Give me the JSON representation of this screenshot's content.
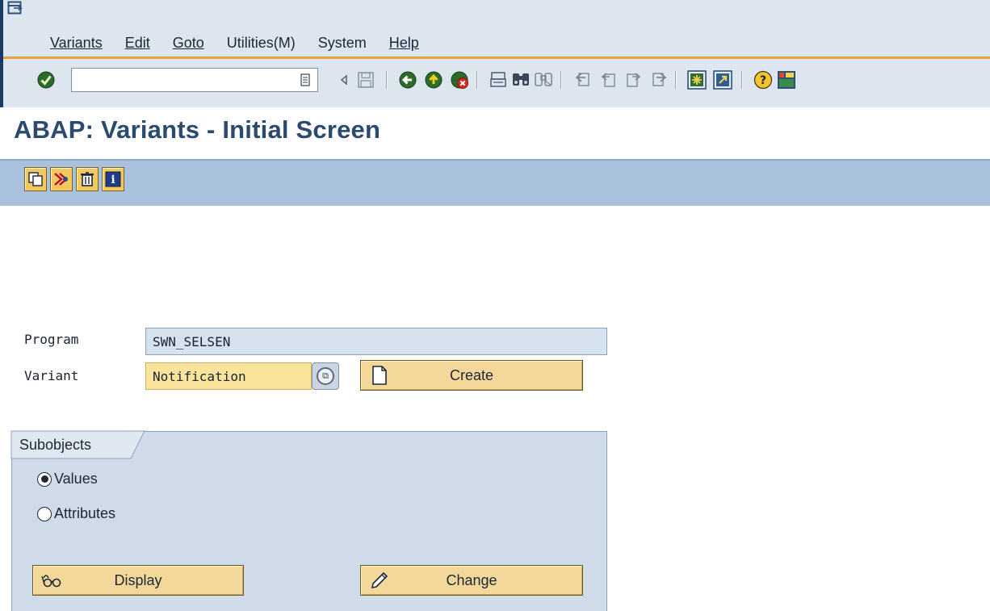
{
  "menu": {
    "items": [
      "Variants",
      "Edit",
      "Goto",
      "Utilities(M)",
      "System",
      "Help"
    ]
  },
  "toolbar": {
    "command_field_value": "",
    "icons": [
      "enter-icon",
      "history-icon",
      "save-icon",
      "back-icon",
      "exit-icon",
      "cancel-icon",
      "print-icon",
      "find-icon",
      "find-next-icon",
      "first-page-icon",
      "previous-page-icon",
      "next-page-icon",
      "last-page-icon",
      "create-session-icon",
      "shortcut-icon",
      "help-icon",
      "layout-menu-icon"
    ]
  },
  "title": "ABAP: Variants - Initial Screen",
  "app_toolbar": {
    "icons": [
      "copy-icon",
      "rename-icon",
      "delete-icon",
      "information-icon"
    ]
  },
  "form": {
    "program_label": "Program",
    "program_value": "SWN_SELSEN",
    "variant_label": "Variant",
    "variant_value": "Notification",
    "create_label": "Create"
  },
  "subobjects": {
    "title": "Subobjects",
    "options": [
      {
        "label": "Values",
        "selected": true
      },
      {
        "label": "Attributes",
        "selected": false
      }
    ],
    "display_label": "Display",
    "change_label": "Change"
  },
  "colors": {
    "accent_orange": "#e6a040",
    "title_blue": "#2b4a6e",
    "app_toolbar": "#a9c1dc",
    "button_gold": "#f3d89a",
    "required_field": "#fae39a"
  }
}
